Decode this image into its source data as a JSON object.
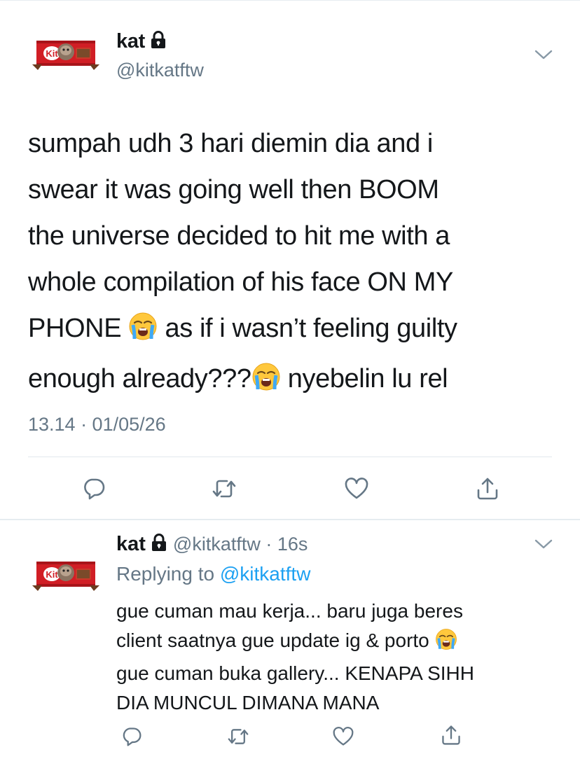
{
  "main_tweet": {
    "display_name": "kat",
    "handle": "@kitkatftw",
    "text_parts": [
      "sumpah udh 3 hari diemin dia and i\nswear it was going well then BOOM\nthe universe decided to hit me with a\nwhole compilation of his face ON MY\nPHONE ",
      " as if i wasn’t feeling guilty\nenough already???",
      " nyebelin lu rel"
    ],
    "timestamp": "13.14 · 01/05/26"
  },
  "reply_tweet": {
    "display_name": "kat",
    "handle_time": "@kitkatftw · 16s",
    "replying_prefix": "Replying to",
    "replying_mention": "@kitkatftw",
    "text_part1": "gue cuman mau kerja... baru juga beres\nclient saatnya gue update ig & porto ",
    "text_part2": "\ngue cuman buka gallery... KENAPA SIHH\nDIA MUNCUL DIMANA MANA"
  },
  "icons": {
    "lock": "lock-icon",
    "chevron": "chevron-down-icon",
    "reply": "comment-icon",
    "retweet": "retweet-icon",
    "like": "heart-icon",
    "share": "share-icon",
    "emoji": "loudly-crying-face-emoji"
  },
  "colors": {
    "text": "#14171a",
    "secondary": "#657786",
    "link": "#1da1f2",
    "kitkat_red": "#d11e25"
  }
}
